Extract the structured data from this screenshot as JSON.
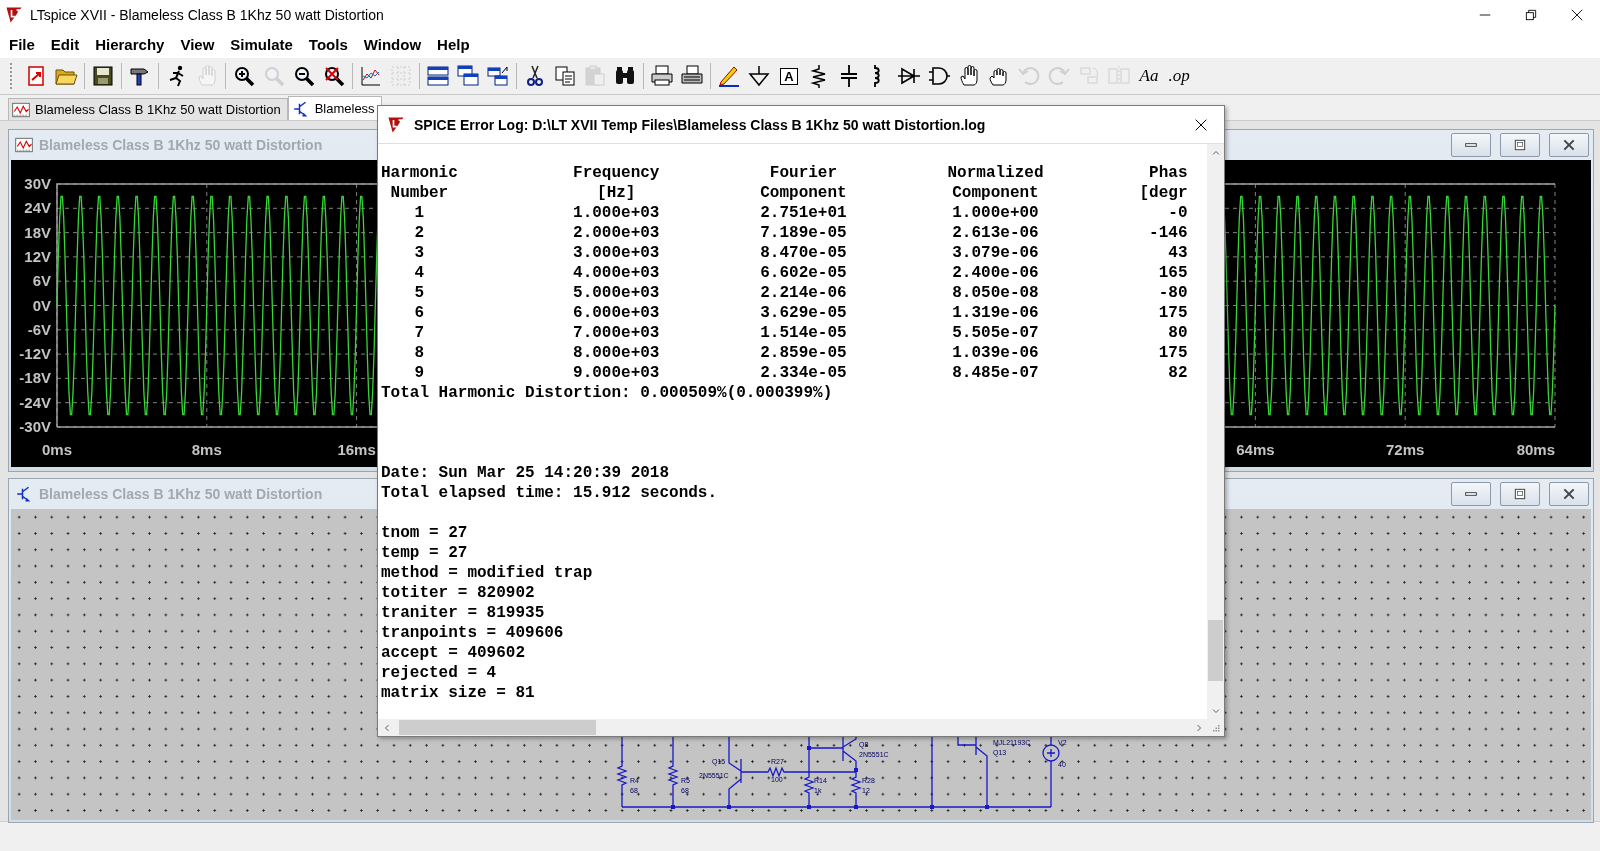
{
  "window": {
    "title": "LTspice XVII - Blameless Class B 1Khz 50 watt Distortion"
  },
  "menu": [
    "File",
    "Edit",
    "Hierarchy",
    "View",
    "Simulate",
    "Tools",
    "Window",
    "Help"
  ],
  "toolbar": [
    {
      "kind": "new",
      "disabled": false
    },
    {
      "kind": "open",
      "disabled": false
    },
    {
      "kind": "save",
      "disabled": false
    },
    {
      "kind": "control",
      "disabled": false
    },
    {
      "kind": "run",
      "disabled": false
    },
    {
      "kind": "halt",
      "disabled": true
    },
    {
      "kind": "zoomin",
      "disabled": false
    },
    {
      "kind": "zoomback",
      "disabled": true
    },
    {
      "kind": "zoomout",
      "disabled": false
    },
    {
      "kind": "autorange",
      "disabled": false
    },
    {
      "kind": "plotset",
      "disabled": false
    },
    {
      "kind": "grid",
      "disabled": true
    },
    {
      "kind": "tileh",
      "disabled": false
    },
    {
      "kind": "cascade",
      "disabled": false
    },
    {
      "kind": "tilev",
      "disabled": false
    },
    {
      "kind": "cut",
      "disabled": false
    },
    {
      "kind": "copy",
      "disabled": false
    },
    {
      "kind": "paste",
      "disabled": true
    },
    {
      "kind": "find",
      "disabled": false
    },
    {
      "kind": "preview",
      "disabled": false
    },
    {
      "kind": "print",
      "disabled": false
    },
    {
      "kind": "wire",
      "disabled": false
    },
    {
      "kind": "ground",
      "disabled": false
    },
    {
      "kind": "label",
      "label": "A",
      "disabled": false
    },
    {
      "kind": "resistor",
      "disabled": false
    },
    {
      "kind": "capacitor",
      "disabled": false
    },
    {
      "kind": "inductor",
      "disabled": false
    },
    {
      "kind": "diode",
      "disabled": false
    },
    {
      "kind": "component",
      "disabled": false
    },
    {
      "kind": "move",
      "disabled": false
    },
    {
      "kind": "drag",
      "disabled": false
    },
    {
      "kind": "undo",
      "disabled": true
    },
    {
      "kind": "redo",
      "disabled": true
    },
    {
      "kind": "rotate",
      "disabled": true
    },
    {
      "kind": "mirror",
      "disabled": true
    },
    {
      "kind": "text",
      "label": "Aa",
      "disabled": false
    },
    {
      "kind": "text",
      "label": ".op",
      "disabled": false
    }
  ],
  "tabs": [
    {
      "label": "Blameless Class B 1Khz 50 watt Distortion",
      "kind": "waveform",
      "selected": false
    },
    {
      "label": "Blameless",
      "kind": "schematic",
      "selected": true
    }
  ],
  "plot_window": {
    "title": "Blameless Class B 1Khz 50 watt Distortion",
    "active": false,
    "y_ticks": [
      "30V",
      "24V",
      "18V",
      "12V",
      "6V",
      "0V",
      "-6V",
      "-12V",
      "-18V",
      "-24V",
      "-30V"
    ],
    "x_ticks": [
      "0ms",
      "8ms",
      "16ms",
      "64ms",
      "72ms",
      "80ms"
    ]
  },
  "schematic_window": {
    "title": "Blameless Class B 1Khz 50 watt Distortion",
    "active": false,
    "labels": [
      "R4",
      "68",
      "R5",
      "68",
      "Q15",
      "2N5551C",
      "R27",
      "100",
      "R14",
      "1k",
      "Q8",
      "2N5551C",
      "R28",
      "12",
      "MJL21193C",
      "Q13",
      "V2",
      "40"
    ]
  },
  "log_dialog": {
    "title": "SPICE Error Log: D:\\LT XVII Temp Files\\Blameless Class B 1Khz 50 watt Distortion.log",
    "table": {
      "header_rows": [
        [
          "Harmonic",
          "Frequency",
          "Fourier",
          "Normalized",
          "Phas"
        ],
        [
          "Number",
          "[Hz]",
          "Component",
          "Component",
          "[degr"
        ]
      ],
      "rows": [
        [
          "1",
          "1.000e+03",
          "2.751e+01",
          "1.000e+00",
          "-0"
        ],
        [
          "2",
          "2.000e+03",
          "7.189e-05",
          "2.613e-06",
          "-146"
        ],
        [
          "3",
          "3.000e+03",
          "8.470e-05",
          "3.079e-06",
          "43"
        ],
        [
          "4",
          "4.000e+03",
          "6.602e-05",
          "2.400e-06",
          "165"
        ],
        [
          "5",
          "5.000e+03",
          "2.214e-06",
          "8.050e-08",
          "-80"
        ],
        [
          "6",
          "6.000e+03",
          "3.629e-05",
          "1.319e-06",
          "175"
        ],
        [
          "7",
          "7.000e+03",
          "1.514e-05",
          "5.505e-07",
          "80"
        ],
        [
          "8",
          "8.000e+03",
          "2.859e-05",
          "1.039e-06",
          "175"
        ],
        [
          "9",
          "9.000e+03",
          "2.334e-05",
          "8.485e-07",
          "82"
        ]
      ]
    },
    "summary": "Total Harmonic Distortion: 0.000509%(0.000399%)",
    "run_info": [
      "Date: Sun Mar 25 14:20:39 2018",
      "Total elapsed time: 15.912 seconds."
    ],
    "options": [
      "tnom = 27",
      "temp = 27",
      "method = modified trap",
      "totiter = 820902",
      "traniter = 819935",
      "tranpoints = 409606",
      "accept = 409602",
      "rejected = 4",
      "matrix size = 81"
    ]
  }
}
